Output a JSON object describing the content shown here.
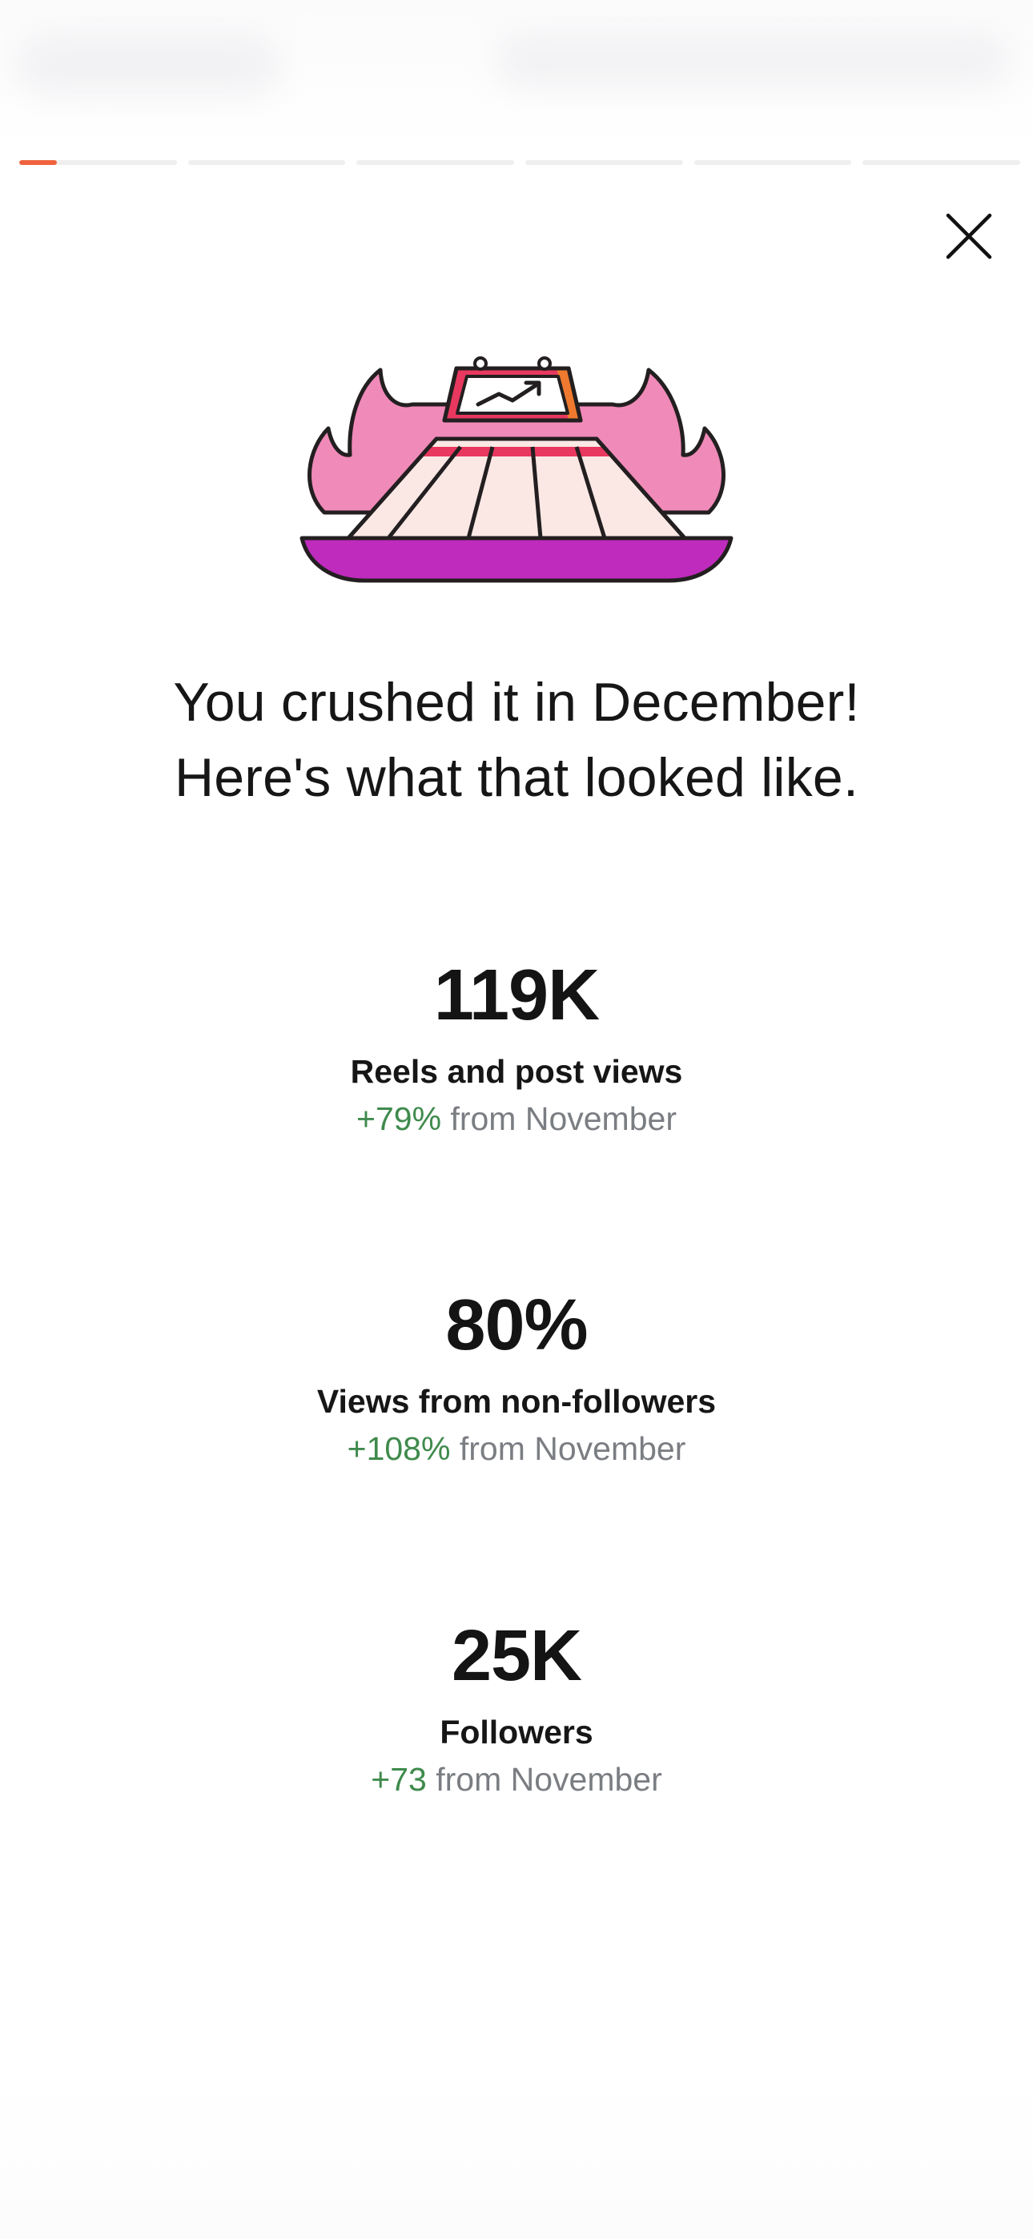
{
  "progress": {
    "segment_count": 6,
    "active_index": 0,
    "active_fraction": 0.24,
    "active_color": "#f0623e"
  },
  "close_button": {
    "icon": "close-icon"
  },
  "illustration": {
    "icon": "flaming-calendar-growth-icon"
  },
  "headline": {
    "line1": "You crushed it in December!",
    "line2": "Here's what that looked like."
  },
  "stats": [
    {
      "value": "119K",
      "label": "Reels and post views",
      "delta": "+79%",
      "from_text": "from November"
    },
    {
      "value": "80%",
      "label": "Views from non-followers",
      "delta": "+108%",
      "from_text": "from November"
    },
    {
      "value": "25K",
      "label": "Followers",
      "delta": "+73",
      "from_text": "from November"
    }
  ],
  "colors": {
    "positive_delta": "#3f8a4c",
    "muted_text": "#7a7d82",
    "accent": "#f0623e",
    "flame_pink": "#f08ab9",
    "tray_purple": "#bf2bbd"
  }
}
